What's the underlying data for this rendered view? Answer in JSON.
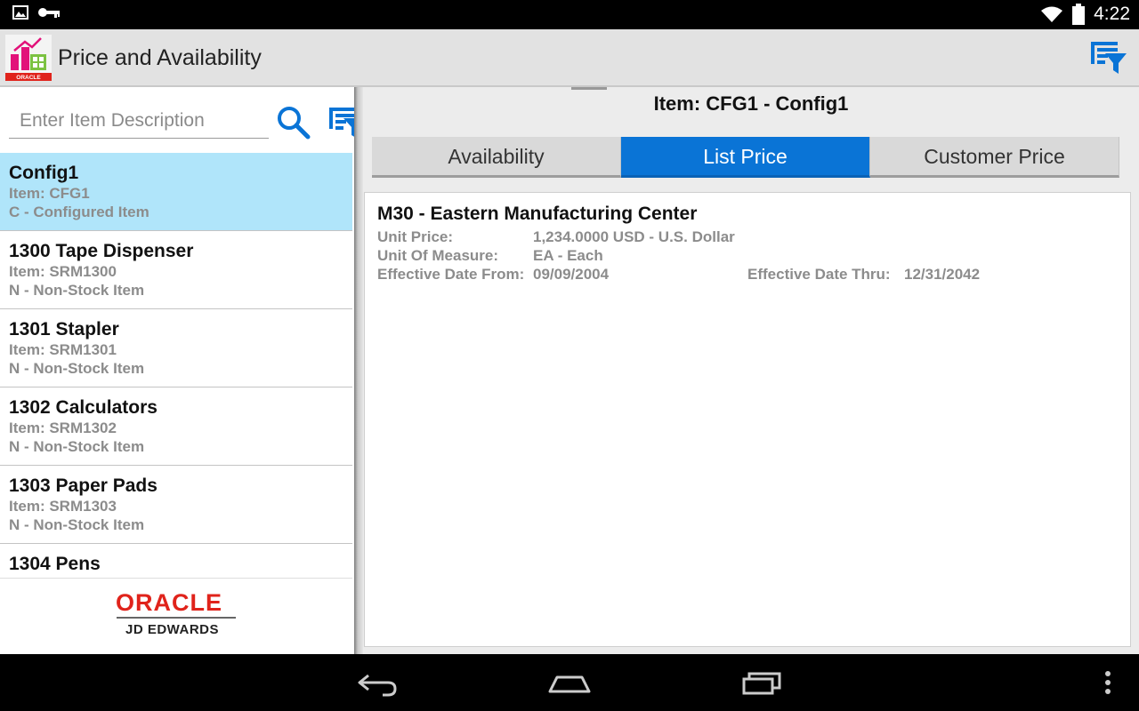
{
  "status_bar": {
    "left_icons": [
      "image-icon",
      "key-icon"
    ],
    "right_icons": [
      "wifi-icon",
      "battery-icon"
    ],
    "time": "4:22"
  },
  "action_bar": {
    "title": "Price and Availability",
    "app_icon": "jde-oracle-app-icon",
    "filter_icon": "filter-list-icon"
  },
  "search": {
    "placeholder": "Enter Item Description",
    "search_icon": "search-icon",
    "filter_icon": "filter-list-icon"
  },
  "items": [
    {
      "name": "Config1",
      "item": "Item: CFG1",
      "type": "C - Configured Item",
      "selected": true
    },
    {
      "name": "1300 Tape Dispenser",
      "item": "Item: SRM1300",
      "type": "N - Non-Stock Item",
      "selected": false
    },
    {
      "name": "1301 Stapler",
      "item": "Item: SRM1301",
      "type": "N - Non-Stock Item",
      "selected": false
    },
    {
      "name": "1302 Calculators",
      "item": "Item: SRM1302",
      "type": "N - Non-Stock Item",
      "selected": false
    },
    {
      "name": "1303 Paper Pads",
      "item": "Item: SRM1303",
      "type": "N - Non-Stock Item",
      "selected": false
    },
    {
      "name": "1304 Pens",
      "item": "",
      "type": "",
      "selected": false
    }
  ],
  "branding": {
    "logo_text": "ORACLE",
    "product": "JD EDWARDS"
  },
  "detail": {
    "header": "Item: CFG1 - Config1",
    "tabs": [
      {
        "label": "Availability",
        "active": false
      },
      {
        "label": "List Price",
        "active": true
      },
      {
        "label": "Customer Price",
        "active": false
      }
    ],
    "branch": "M30 - Eastern Manufacturing Center",
    "unit_price_label": "Unit Price:",
    "unit_price_value": "1,234.0000 USD - U.S. Dollar",
    "uom_label": "Unit Of Measure:",
    "uom_value": "EA - Each",
    "eff_from_label": "Effective Date From:",
    "eff_from_value": "09/09/2004",
    "eff_thru_label": "Effective Date Thru:",
    "eff_thru_value": "12/31/2042"
  },
  "nav_bar": {
    "buttons": [
      "back-icon",
      "home-icon",
      "recent-apps-icon",
      "overflow-menu-icon"
    ]
  },
  "colors": {
    "accent": "#0A74D6",
    "selected_row": "#B0E5FA",
    "oracle_red": "#E0231B",
    "secondary_text": "#8C8C8C"
  }
}
